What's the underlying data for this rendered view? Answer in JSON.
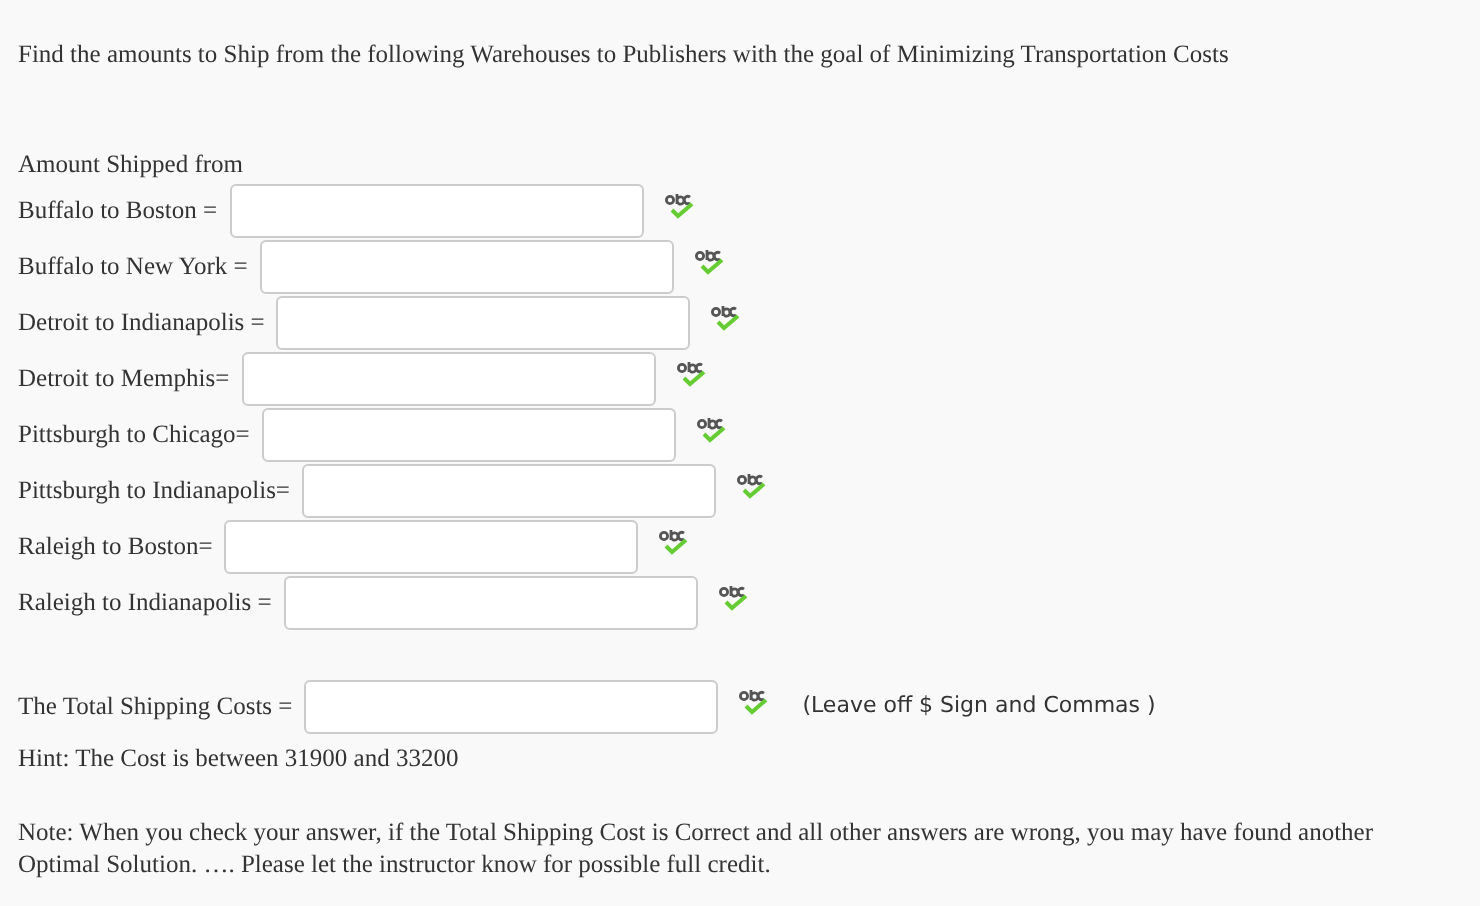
{
  "heading": "Find the amounts to Ship from the following Warehouses to Publishers with the goal of Minimizing Transportation Costs",
  "section_label": "Amount Shipped from",
  "fields": [
    {
      "label": "Buffalo to Boston ="
    },
    {
      "label": "Buffalo to New York ="
    },
    {
      "label": "Detroit to Indianapolis ="
    },
    {
      "label": "Detroit to Memphis="
    },
    {
      "label": "Pittsburgh to Chicago="
    },
    {
      "label": "Pittsburgh to Indianapolis="
    },
    {
      "label": "Raleigh to Boston="
    },
    {
      "label": "Raleigh to Indianapolis ="
    }
  ],
  "total": {
    "label": "The Total Shipping Costs =",
    "note": "(Leave off $ Sign and Commas )"
  },
  "hint": "Hint: The Cost is between 31900 and 33200",
  "note": "Note: When you check your answer, if the Total Shipping Cost is Correct and all other answers are wrong, you may have found another Optimal Solution. …. Please let the instructor know for possible full credit."
}
